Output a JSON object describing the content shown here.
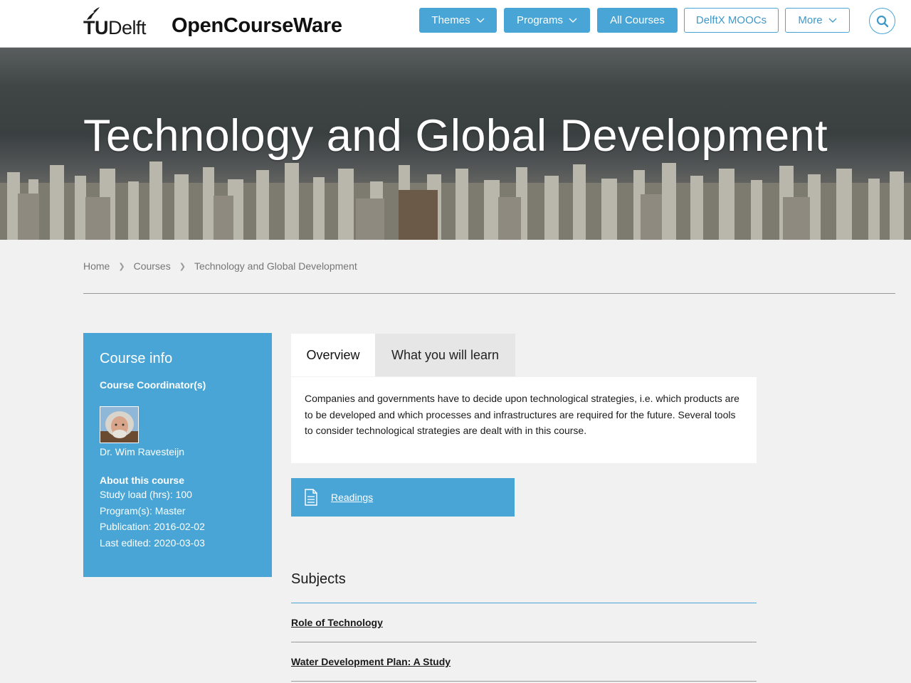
{
  "header": {
    "logo_prefix": "TU",
    "logo_suffix": "Delft",
    "site_title": "OpenCourseWare",
    "nav": [
      {
        "label": "Themes",
        "style": "solid",
        "dropdown": true
      },
      {
        "label": "Programs",
        "style": "solid",
        "dropdown": true
      },
      {
        "label": "All Courses",
        "style": "solid",
        "dropdown": false
      },
      {
        "label": "DelftX MOOCs",
        "style": "outline",
        "dropdown": false
      },
      {
        "label": "More",
        "style": "outline",
        "dropdown": true
      }
    ],
    "search_icon": "search-icon"
  },
  "hero": {
    "title": "Technology and Global Development"
  },
  "breadcrumb": [
    "Home",
    "Courses",
    "Technology and Global Development"
  ],
  "course_info": {
    "title": "Course info",
    "coordinator_label": "Course Coordinator(s)",
    "coordinator_name": "Dr. Wim Ravesteijn",
    "about_label": "About this course",
    "study_load": "Study load (hrs): 100",
    "programs": "Program(s): Master",
    "publication": "Publication: 2016-02-02",
    "last_edited": "Last edited: 2020-03-03"
  },
  "tabs": [
    {
      "label": "Overview",
      "active": true
    },
    {
      "label": "What you will learn",
      "active": false
    }
  ],
  "overview": {
    "text": "Companies and governments have to decide upon technological strategies, i.e. which products are to be developed and which processes and infrastructures are required for the future. Several tools to consider technological strategies are dealt with in this course."
  },
  "readings": {
    "label": "Readings",
    "icon": "document-icon"
  },
  "subjects": {
    "title": "Subjects",
    "items": [
      "Role of Technology",
      "Water Development Plan: A Study"
    ]
  },
  "colors": {
    "accent": "#48a5d5",
    "header_bg": "#ffffff",
    "page_bg": "#f1f1f1"
  }
}
